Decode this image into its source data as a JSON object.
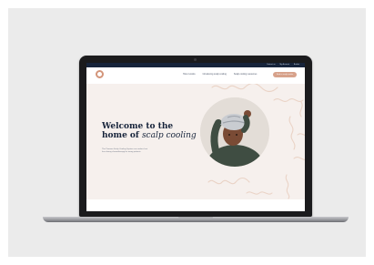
{
  "utility_bar": {
    "links": [
      "Contact us",
      "My Account",
      "Basket"
    ]
  },
  "header": {
    "nav": [
      "How it works",
      "Introducing scalp cooling",
      "Scalp cooling resources"
    ],
    "cta_label": "Find a scalp cooler"
  },
  "hero": {
    "title_line1": "Welcome to the",
    "title_line2_plain": "home of ",
    "title_line2_emphasis": "scalp cooling",
    "body": "The Paxman Scalp Cooling System can reduce hair loss during chemotherapy for many patients."
  },
  "colors": {
    "navy": "#17243b",
    "accent": "#d7a28b",
    "hero_background": "#f6f0ed"
  }
}
